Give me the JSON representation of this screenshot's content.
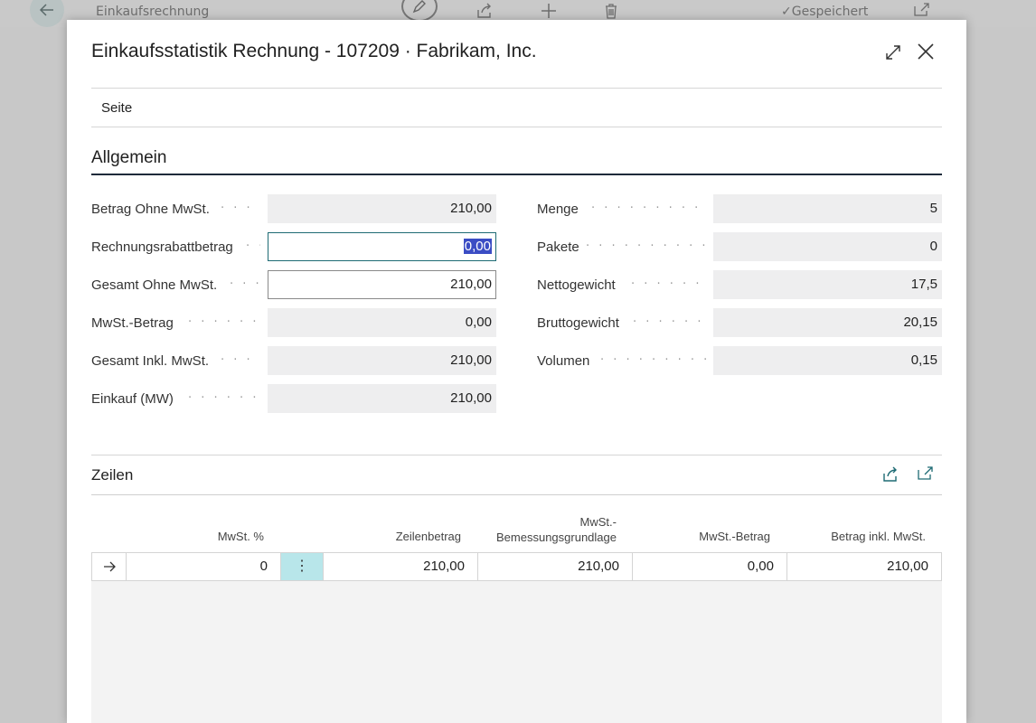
{
  "background": {
    "title": "Einkaufsrechnung",
    "saved_label": "Gespeichert"
  },
  "dialog": {
    "title": "Einkaufsstatistik Rechnung - 107209 · Fabrikam, Inc.",
    "menu": {
      "page": "Seite"
    }
  },
  "general": {
    "heading": "Allgemein",
    "left_fields": [
      {
        "label": "Betrag Ohne MwSt.",
        "value": "210,00"
      },
      {
        "label": "Rechnungsrabattbetrag",
        "value": "0,00"
      },
      {
        "label": "Gesamt Ohne MwSt.",
        "value": "210,00"
      },
      {
        "label": "MwSt.-Betrag",
        "value": "0,00"
      },
      {
        "label": "Gesamt Inkl. MwSt.",
        "value": "210,00"
      },
      {
        "label": "Einkauf (MW)",
        "value": "210,00"
      }
    ],
    "right_fields": [
      {
        "label": "Menge",
        "value": "5"
      },
      {
        "label": "Pakete",
        "value": "0"
      },
      {
        "label": "Nettogewicht",
        "value": "17,5"
      },
      {
        "label": "Bruttogewicht",
        "value": "20,15"
      },
      {
        "label": "Volumen",
        "value": "0,15"
      }
    ]
  },
  "lines": {
    "heading": "Zeilen",
    "columns": {
      "vat_percent": "MwSt. %",
      "line_amount": "Zeilenbetrag",
      "vat_base_1": "MwSt.-",
      "vat_base_2": "Bemessungsgrundlage",
      "vat_amount": "MwSt.-Betrag",
      "amount_incl_vat": "Betrag inkl. MwSt."
    },
    "rows": [
      {
        "vat_percent": "0",
        "line_amount": "210,00",
        "vat_base": "210,00",
        "vat_amount": "0,00",
        "amount_incl_vat": "210,00"
      }
    ]
  },
  "colors": {
    "accent": "#1e6b74",
    "selection": "#3b4dc4",
    "row_menu_bg": "#b8e6ea"
  }
}
